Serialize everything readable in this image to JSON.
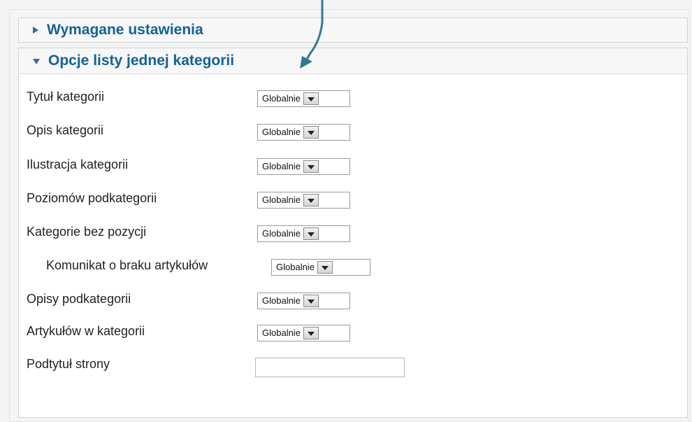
{
  "sections": [
    {
      "title": "Wymagane ustawienia",
      "expanded": false
    },
    {
      "title": "Opcje listy jednej kategorii",
      "expanded": true
    }
  ],
  "options": [
    {
      "label": "Tytuł kategorii",
      "value": "Globalnie"
    },
    {
      "label": "Opis kategorii",
      "value": "Globalnie"
    },
    {
      "label": "Ilustracja kategorii",
      "value": "Globalnie"
    },
    {
      "label": "Poziomów podkategorii",
      "value": "Globalnie"
    },
    {
      "label": "Kategorie bez pozycji",
      "value": "Globalnie"
    },
    {
      "label": "Komunikat o braku artykułów",
      "value": "Globalnie"
    },
    {
      "label": "Opisy podkategorii",
      "value": "Globalnie"
    },
    {
      "label": "Artykułów w kategorii",
      "value": "Globalnie"
    }
  ],
  "subtitle_field": {
    "label": "Podtytuł strony",
    "value": ""
  },
  "colors": {
    "header_text": "#146295",
    "arrow": "#2f7a8f"
  }
}
